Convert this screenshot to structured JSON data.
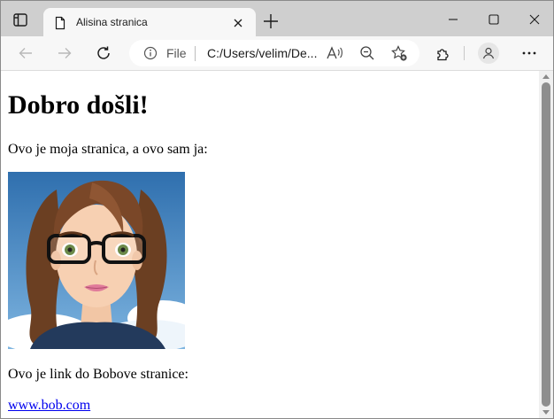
{
  "browser": {
    "tab": {
      "title": "Alisina stranica"
    },
    "address_bar": {
      "scheme_label": "File",
      "url": "C:/Users/velim/De..."
    },
    "icons": [
      "tab-actions-icon",
      "page-icon",
      "close-icon",
      "plus-icon",
      "minimize-icon",
      "maximize-icon",
      "close-icon",
      "back-arrow-icon",
      "forward-arrow-icon",
      "refresh-icon",
      "info-icon",
      "read-aloud-icon",
      "zoom-out-icon",
      "favorites-add-icon",
      "extensions-icon",
      "profile-icon",
      "more-icon"
    ]
  },
  "page": {
    "heading": "Dobro došli!",
    "intro": "Ovo je moja stranica, a ovo sam ja:",
    "link_text": "Ovo je link do Bobove stranice:",
    "link": "www.bob.com"
  },
  "colors": {
    "link": "#0000ee",
    "tabstrip": "#cfcfcf",
    "toolbar": "#f7f7f7"
  }
}
